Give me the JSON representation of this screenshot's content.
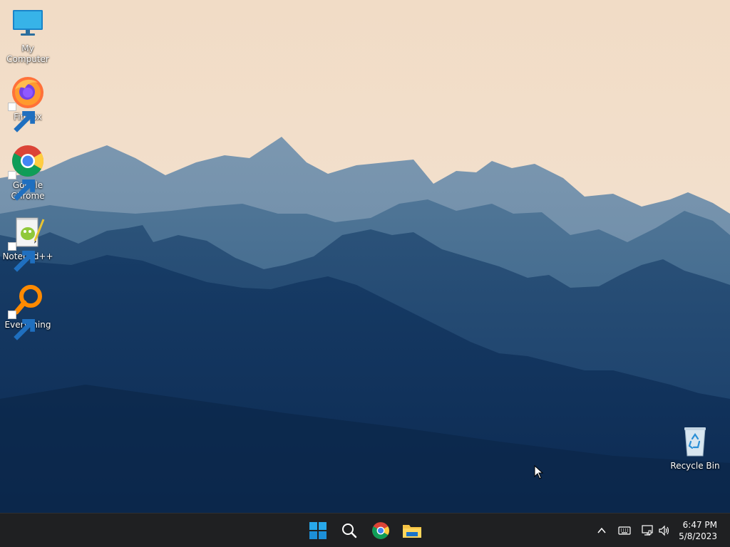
{
  "desktop": {
    "icons": [
      {
        "label": "My Computer",
        "icon": "monitor-icon"
      },
      {
        "label": "Firefox",
        "icon": "firefox-icon"
      },
      {
        "label": "Google Chrome",
        "icon": "chrome-icon"
      },
      {
        "label": "Notepad++",
        "icon": "notepadpp-icon"
      },
      {
        "label": "Everything",
        "icon": "everything-icon"
      },
      {
        "label": "Recycle Bin",
        "icon": "recycle-bin-icon"
      }
    ]
  },
  "taskbar": {
    "pinned": [
      {
        "name": "Start",
        "icon": "windows-start-icon"
      },
      {
        "name": "Search",
        "icon": "search-icon"
      },
      {
        "name": "Google Chrome",
        "icon": "chrome-icon"
      },
      {
        "name": "File Explorer",
        "icon": "folder-icon"
      }
    ],
    "tray": {
      "icons": [
        "chevron-up-icon",
        "keyboard-icon",
        "network-icon",
        "volume-icon"
      ]
    },
    "clock": {
      "time": "6:47 PM",
      "date": "5/8/2023"
    }
  },
  "colors": {
    "taskbar_bg": "#1f2022",
    "sky_top": "#f3dfcb",
    "sky_bottom": "#efd6bd",
    "mountain_far": "#6f8ea9",
    "mountain_deep": "#0d2b52"
  }
}
